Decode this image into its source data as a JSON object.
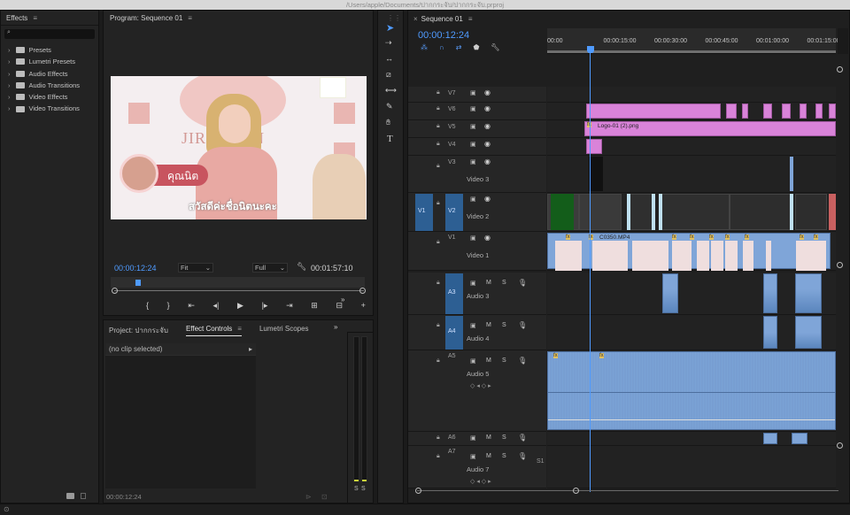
{
  "window_title": "/Users/apple/Documents/ปากกระจับ/ปากกระจับ.prproj",
  "effects": {
    "title": "Effects",
    "search_placeholder": "",
    "items": [
      "Presets",
      "Lumetri Presets",
      "Audio Effects",
      "Audio Transitions",
      "Video Effects",
      "Video Transitions"
    ]
  },
  "program": {
    "title": "Program: Sequence 01",
    "timecode": "00:00:12:24",
    "fit_label": "Fit",
    "quality_label": "Full",
    "duration": "00:01:57:10",
    "video_name_text": "คุณนิต",
    "video_caption_text": "สวัสดีค่ะชื่อนิตนะคะ",
    "video_bg_text": "JIRAPORN"
  },
  "lower_panel": {
    "tabs": [
      "Project: ปากกระจับ",
      "Effect Controls",
      "Lumetri Scopes"
    ],
    "active_tab": 1,
    "no_clip": "(no clip selected)",
    "timecode": "00:00:12:24"
  },
  "tools": [
    "selection",
    "track-select",
    "ripple-edit",
    "razor",
    "slip",
    "pen",
    "hand",
    "type"
  ],
  "sequence": {
    "tab": "Sequence 01",
    "timecode": "00:00:12:24",
    "ruler": [
      "00:00",
      "00:00:15:00",
      "00:00:30:00",
      "00:00:45:00",
      "00:01:00:00",
      "00:01:15:00"
    ],
    "video_tracks": [
      {
        "id": "V7",
        "name": ""
      },
      {
        "id": "V6",
        "name": ""
      },
      {
        "id": "V5",
        "name": ""
      },
      {
        "id": "V4",
        "name": ""
      },
      {
        "id": "V3",
        "name": "Video 3"
      },
      {
        "id": "V2",
        "name": "Video 2",
        "src": "V1"
      },
      {
        "id": "V1",
        "name": "Video 1"
      }
    ],
    "audio_tracks": [
      {
        "id": "A3",
        "name": "Audio 3"
      },
      {
        "id": "A4",
        "name": "Audio 4"
      },
      {
        "id": "A5",
        "name": "Audio 5"
      },
      {
        "id": "A6",
        "name": ""
      },
      {
        "id": "A7",
        "name": "Audio 7"
      }
    ],
    "clips": {
      "v5_logo": "Logo-01 (2).png",
      "v1_main": "C0350.MP4"
    },
    "meter_labels": [
      "S",
      "S"
    ],
    "solo_label": "S1"
  },
  "colors": {
    "accent": "#4f9bff",
    "video_clip": "#d983d9",
    "audio_clip": "#7fa5d8",
    "track_target": "#2d5f93"
  }
}
